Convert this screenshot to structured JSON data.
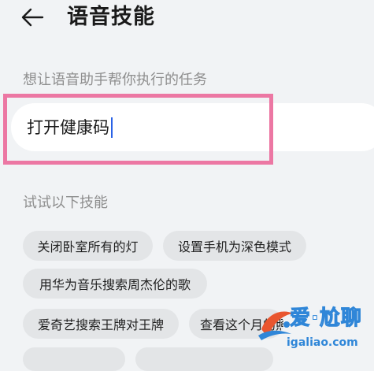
{
  "header": {
    "back_icon": "arrow-left-icon",
    "title": "语音技能"
  },
  "task_section": {
    "label": "想让语音助手帮你执行的任务",
    "input_value": "打开健康码"
  },
  "skills_section": {
    "label": "试试以下技能",
    "chips": [
      "关闭卧室所有的灯",
      "设置手机为深色模式",
      "用华为音乐搜索周杰伦的歌",
      "爱奇艺搜索王牌对王牌",
      "查看这个月的照片",
      "",
      ""
    ]
  },
  "watermark": {
    "brand": "爱·尬聊",
    "domain": "igaliao.com"
  },
  "colors": {
    "background": "#f1f3f5",
    "card": "#ffffff",
    "chip": "#e3e5e7",
    "highlight": "#ec77a3",
    "caret": "#2a62e6",
    "watermark": "#2f86d8"
  }
}
